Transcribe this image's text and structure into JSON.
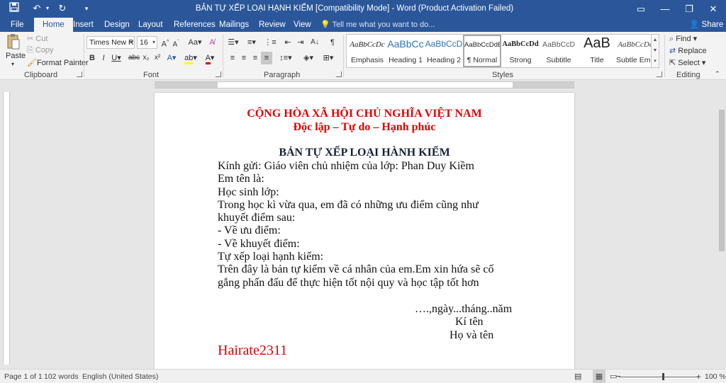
{
  "window": {
    "title": "BẢN TỰ XẾP LOẠI HẠNH KIỂM [Compatibility Mode] - Word (Product Activation Failed)"
  },
  "tabs": [
    "File",
    "Home",
    "Insert",
    "Design",
    "Layout",
    "References",
    "Mailings",
    "Review",
    "View"
  ],
  "active_tab": "Home",
  "tell_me": "Tell me what you want to do...",
  "share": "Share",
  "clipboard": {
    "paste": "Paste",
    "cut": "Cut",
    "copy": "Copy",
    "format_painter": "Format Painter",
    "label": "Clipboard"
  },
  "font": {
    "name": "Times New Ro",
    "size": "16",
    "label": "Font"
  },
  "paragraph": {
    "label": "Paragraph"
  },
  "styles": {
    "label": "Styles",
    "items": [
      {
        "preview": "AaBbCcDc",
        "name": "Emphasis"
      },
      {
        "preview": "AaBbCc",
        "name": "Heading 1"
      },
      {
        "preview": "AaBbCcD",
        "name": "Heading 2"
      },
      {
        "preview": "AaBbCcDdE",
        "name": "¶ Normal"
      },
      {
        "preview": "AaBbCcDd",
        "name": "Strong"
      },
      {
        "preview": "AaBbCcD",
        "name": "Subtitle"
      },
      {
        "preview": "AaB",
        "name": "Title"
      },
      {
        "preview": "AaBbCcDc",
        "name": "Subtle Em..."
      }
    ],
    "selected": "¶ Normal"
  },
  "editing": {
    "find": "Find",
    "replace": "Replace",
    "select": "Select",
    "label": "Editing"
  },
  "document": {
    "header1": "CỘNG HÒA XÃ HỘI CHỦ NGHĨA VIỆT NAM",
    "header2": "Độc lập – Tự do – Hạnh phúc",
    "title": "BẢN TỰ XẾP LOẠI HÀNH KIỂM",
    "lines": [
      "Kính gửi: Giáo viên chủ nhiệm của lớp: Phan Duy Kiềm",
      "Em tên là:",
      "Học sinh lớp:",
      "Trong học kì vừa qua, em đã có những ưu điểm cũng như",
      "khuyết điểm sau:",
      "- Về ưu điểm:",
      "- Về khuyết điểm:",
      "Tự xếp loại hạnh kiểm:",
      "Trên đây là bản tự kiểm về cá nhân của em.Em xin hứa sẽ cố",
      "gắng phấn đấu để thực hiện tốt nội quy và học tập tốt hơn"
    ],
    "date_line": "….,ngày...tháng..năm",
    "sign": "Kí tên",
    "fullname": "Họ và tên",
    "signature": "Hairate2311"
  },
  "status": {
    "page": "Page 1 of 1",
    "words": "102 words",
    "language": "English (United States)",
    "zoom": "100 %"
  },
  "colors": {
    "accent": "#2b579a",
    "doc_red": "#e00000"
  }
}
